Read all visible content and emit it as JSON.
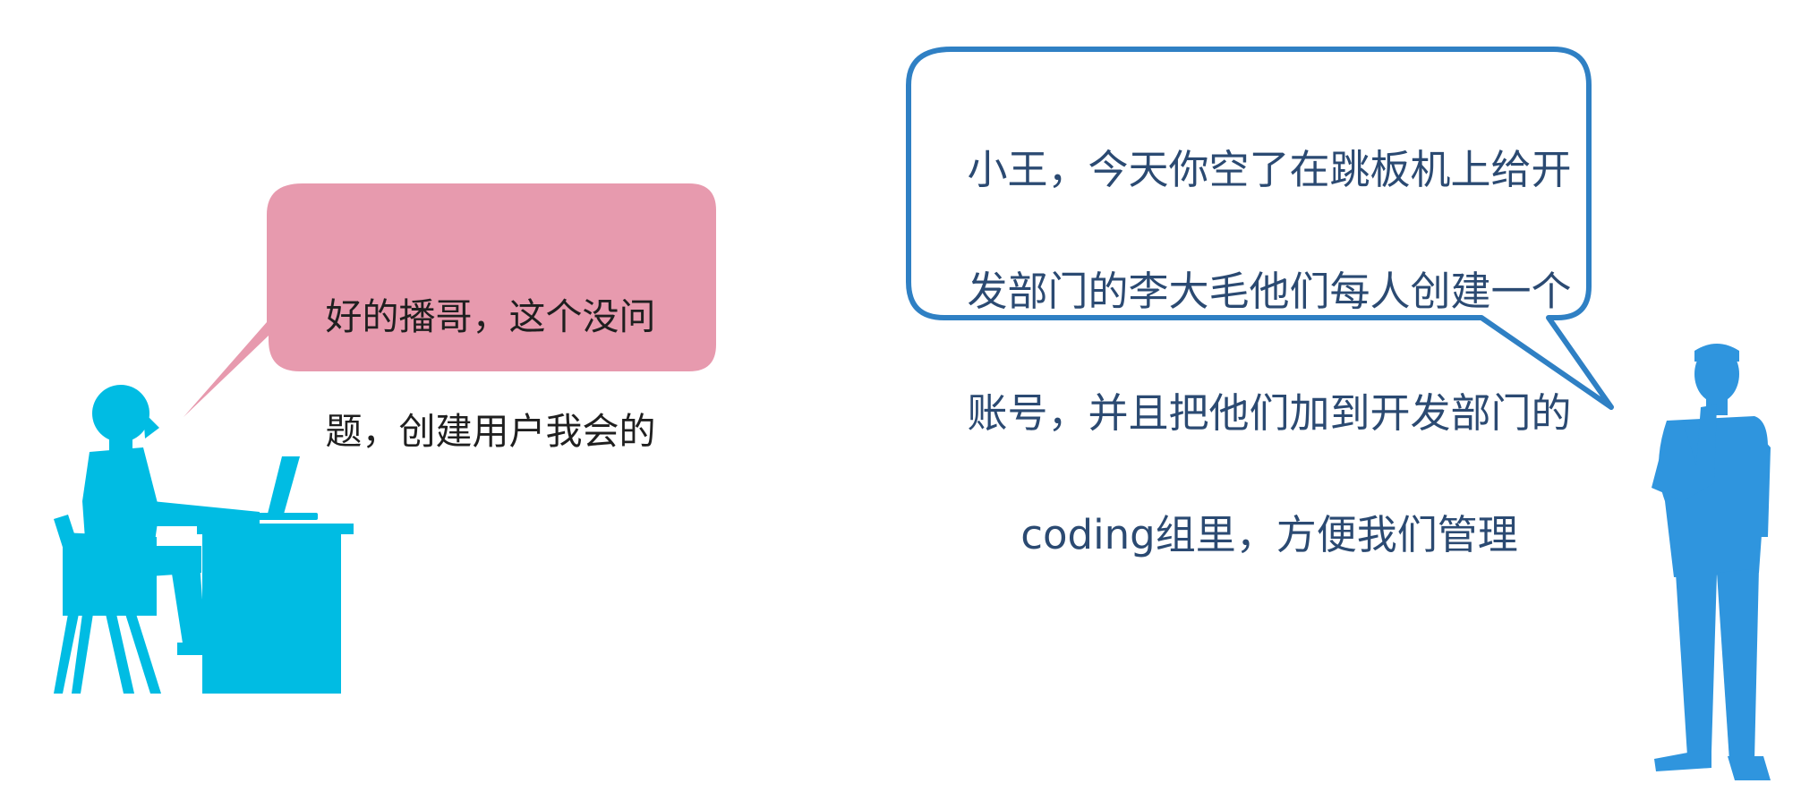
{
  "left_bubble": {
    "text_line1": "好的播哥，这个没问",
    "text_line2": "题，创建用户我会的"
  },
  "right_bubble": {
    "text_line1": "小王，今天你空了在跳板机上给开",
    "text_line2": "发部门的李大毛他们每人创建一个",
    "text_line3": "账号，并且把他们加到开发部门的",
    "text_line4": "coding组里，方便我们管理"
  },
  "colors": {
    "left_bubble_fill": "#E79AAE",
    "right_bubble_stroke": "#2F80C4",
    "worker_color": "#00BCE3",
    "boss_color": "#2F95DE"
  },
  "icons": {
    "worker": "seated-person-at-desk-silhouette",
    "boss": "standing-thinking-man-silhouette"
  }
}
